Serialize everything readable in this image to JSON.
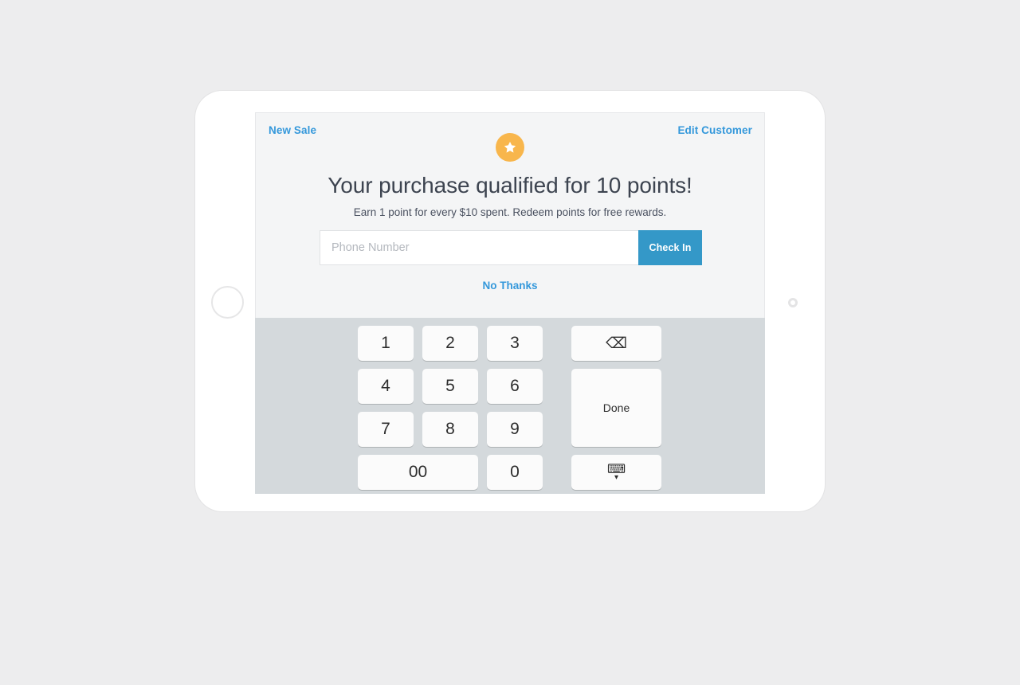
{
  "device": {
    "name": "tablet",
    "home_button": "home-button",
    "camera": "front-camera"
  },
  "colors": {
    "page_background": "#ededee",
    "screen_background": "#f4f5f6",
    "keypad_background": "#d4d9dc",
    "link_blue": "#3498db",
    "primary_button_blue": "#3498c8",
    "badge_orange": "#f8b64c",
    "key_white": "#fbfbfb",
    "heading_text": "#3d4450"
  },
  "header": {
    "new_sale_label": "New Sale",
    "edit_customer_label": "Edit Customer",
    "badge_icon": "star-icon"
  },
  "main": {
    "headline": "Your purchase qualified for 10 points!",
    "subheadline": "Earn 1 point for every $10 spent. Redeem points for free rewards.",
    "points_earned": 10,
    "points_rate": "1 point for every $10 spent"
  },
  "checkin": {
    "phone_placeholder": "Phone Number",
    "phone_value": "",
    "check_in_label": "Check In",
    "no_thanks_label": "No Thanks"
  },
  "keypad": {
    "keys": [
      {
        "label": "1",
        "name": "keypad-key-1"
      },
      {
        "label": "2",
        "name": "keypad-key-2"
      },
      {
        "label": "3",
        "name": "keypad-key-3"
      },
      {
        "label": "4",
        "name": "keypad-key-4"
      },
      {
        "label": "5",
        "name": "keypad-key-5"
      },
      {
        "label": "6",
        "name": "keypad-key-6"
      },
      {
        "label": "7",
        "name": "keypad-key-7"
      },
      {
        "label": "8",
        "name": "keypad-key-8"
      },
      {
        "label": "9",
        "name": "keypad-key-9"
      },
      {
        "label": "00",
        "name": "keypad-key-00"
      },
      {
        "label": "0",
        "name": "keypad-key-0"
      }
    ],
    "backspace_glyph": "⌫",
    "backspace_name": "backspace-icon",
    "done_label": "Done",
    "dismiss_keyboard_glyph": "⌨",
    "dismiss_chevron_glyph": "▾",
    "dismiss_name": "keyboard-dismiss-icon"
  }
}
